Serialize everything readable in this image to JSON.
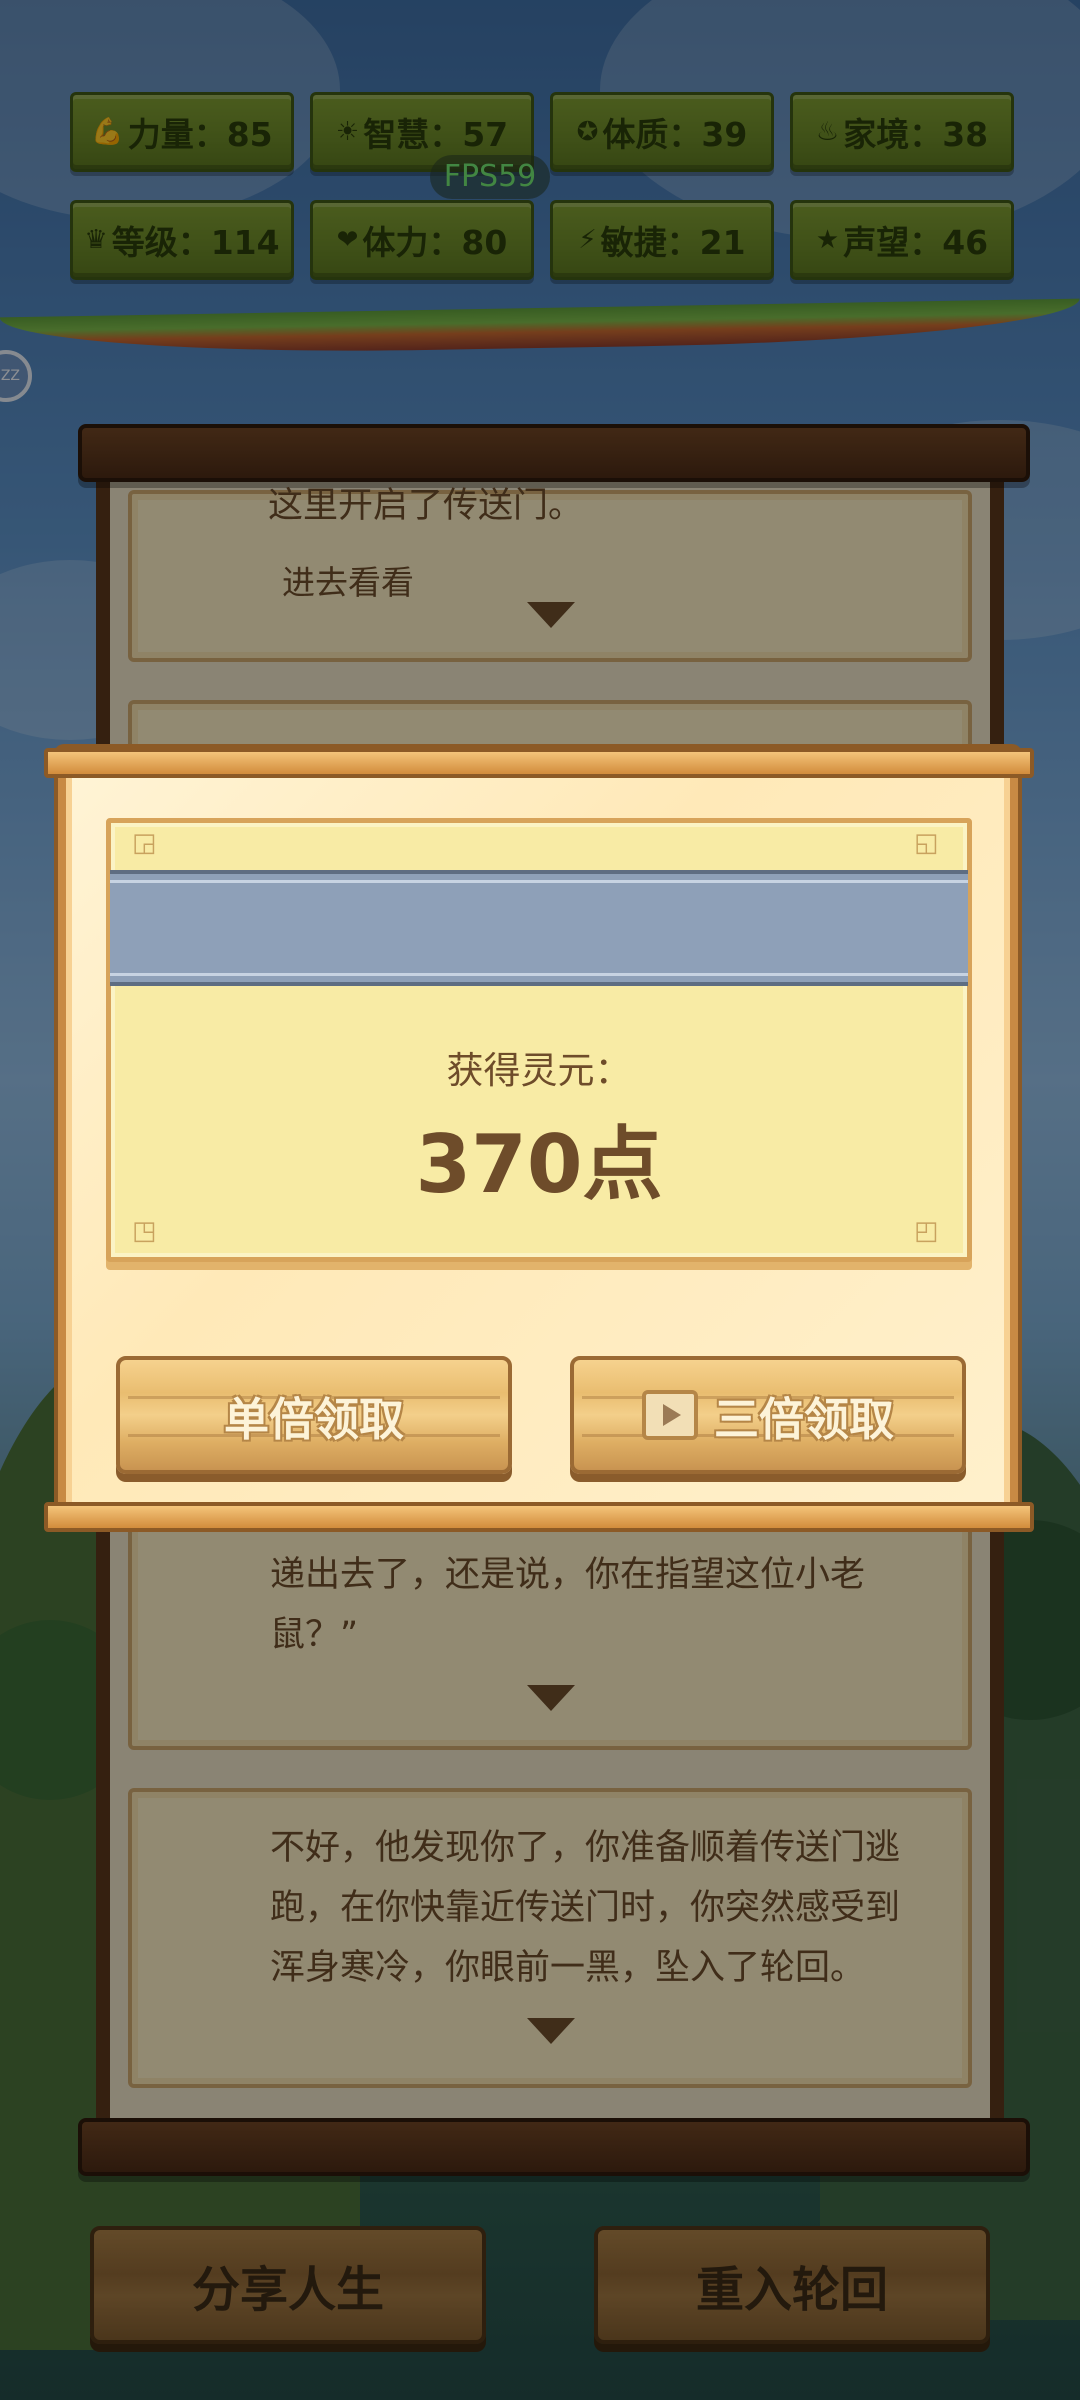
{
  "hud": {
    "fps": "FPS59",
    "badge": "ZZ",
    "stats": [
      {
        "icon": "muscle-icon",
        "glyph": "💪",
        "label": "力量：85"
      },
      {
        "icon": "bulb-icon",
        "glyph": "☀",
        "label": "智慧：57"
      },
      {
        "icon": "constitution-icon",
        "glyph": "✪",
        "label": "体质：39"
      },
      {
        "icon": "family-icon",
        "glyph": "♨",
        "label": "家境：38"
      },
      {
        "icon": "crown-icon",
        "glyph": "♛",
        "label": "等级：114"
      },
      {
        "icon": "heart-icon",
        "glyph": "❤",
        "label": "体力：80"
      },
      {
        "icon": "lightning-icon",
        "glyph": "⚡",
        "label": "敏捷：21"
      },
      {
        "icon": "star-icon",
        "glyph": "★",
        "label": "声望：46"
      }
    ]
  },
  "story": {
    "card1_partial": "这里开启了传送门。",
    "card1_choice": "进去看看",
    "card3_text": "递出去了，还是说，你在指望这位小老鼠？”",
    "card4_text": "不好，他发现你了，你准备顺着传送门逃跑，在你快靠近传送门时，你突然感受到浑身寒冷，你眼前一黑，坠入了轮回。"
  },
  "dialog": {
    "reward_label": "获得灵元：",
    "reward_value": "370点",
    "single_button": "单倍领取",
    "triple_button": "三倍领取"
  },
  "footer": {
    "share_button": "分享人生",
    "restart_button": "重入轮回"
  }
}
